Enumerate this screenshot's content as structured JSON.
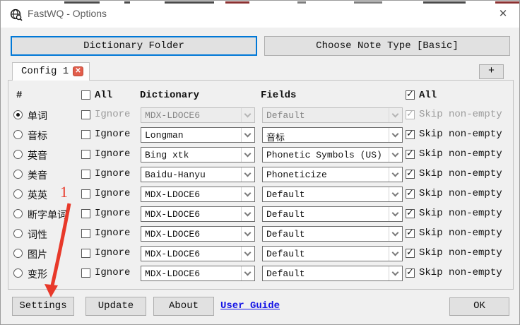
{
  "window": {
    "title": "FastWQ - Options",
    "close_glyph": "✕"
  },
  "top_buttons": {
    "dictionary_folder": "Dictionary Folder",
    "choose_note_type": "Choose Note Type [Basic]"
  },
  "tabs": {
    "config_tab": "Config 1",
    "tab_close_glyph": "✕",
    "add_tab": "+"
  },
  "table": {
    "headers": {
      "hash": "#",
      "all_left": "All",
      "all_left_checked": false,
      "dictionary": "Dictionary",
      "fields": "Fields",
      "all_right": "All",
      "all_right_checked": true
    },
    "ignore_label": "Ignore",
    "skip_label": "Skip non-empty",
    "rows": [
      {
        "label": "单词",
        "selected": true,
        "disabled": true,
        "ignore_checked": false,
        "dictionary": "MDX-LDOCE6",
        "field": "Default",
        "skip_checked": true
      },
      {
        "label": "音标",
        "selected": false,
        "disabled": false,
        "ignore_checked": false,
        "dictionary": "Longman",
        "field": "音标",
        "skip_checked": true
      },
      {
        "label": "英音",
        "selected": false,
        "disabled": false,
        "ignore_checked": false,
        "dictionary": "Bing xtk",
        "field": "Phonetic Symbols (US)",
        "skip_checked": true
      },
      {
        "label": "美音",
        "selected": false,
        "disabled": false,
        "ignore_checked": false,
        "dictionary": "Baidu-Hanyu",
        "field": "Phoneticize",
        "skip_checked": true
      },
      {
        "label": "英英",
        "selected": false,
        "disabled": false,
        "ignore_checked": false,
        "dictionary": "MDX-LDOCE6",
        "field": "Default",
        "skip_checked": true
      },
      {
        "label": "断字单词",
        "selected": false,
        "disabled": false,
        "ignore_checked": false,
        "dictionary": "MDX-LDOCE6",
        "field": "Default",
        "skip_checked": true
      },
      {
        "label": "词性",
        "selected": false,
        "disabled": false,
        "ignore_checked": false,
        "dictionary": "MDX-LDOCE6",
        "field": "Default",
        "skip_checked": true
      },
      {
        "label": "图片",
        "selected": false,
        "disabled": false,
        "ignore_checked": false,
        "dictionary": "MDX-LDOCE6",
        "field": "Default",
        "skip_checked": true
      },
      {
        "label": "变形",
        "selected": false,
        "disabled": false,
        "ignore_checked": false,
        "dictionary": "MDX-LDOCE6",
        "field": "Default",
        "skip_checked": true
      }
    ]
  },
  "footer": {
    "settings": "Settings",
    "update": "Update",
    "about": "About",
    "user_guide": "User Guide",
    "ok": "OK"
  },
  "annotation": {
    "step_label": "1",
    "color": "#e8392a"
  }
}
